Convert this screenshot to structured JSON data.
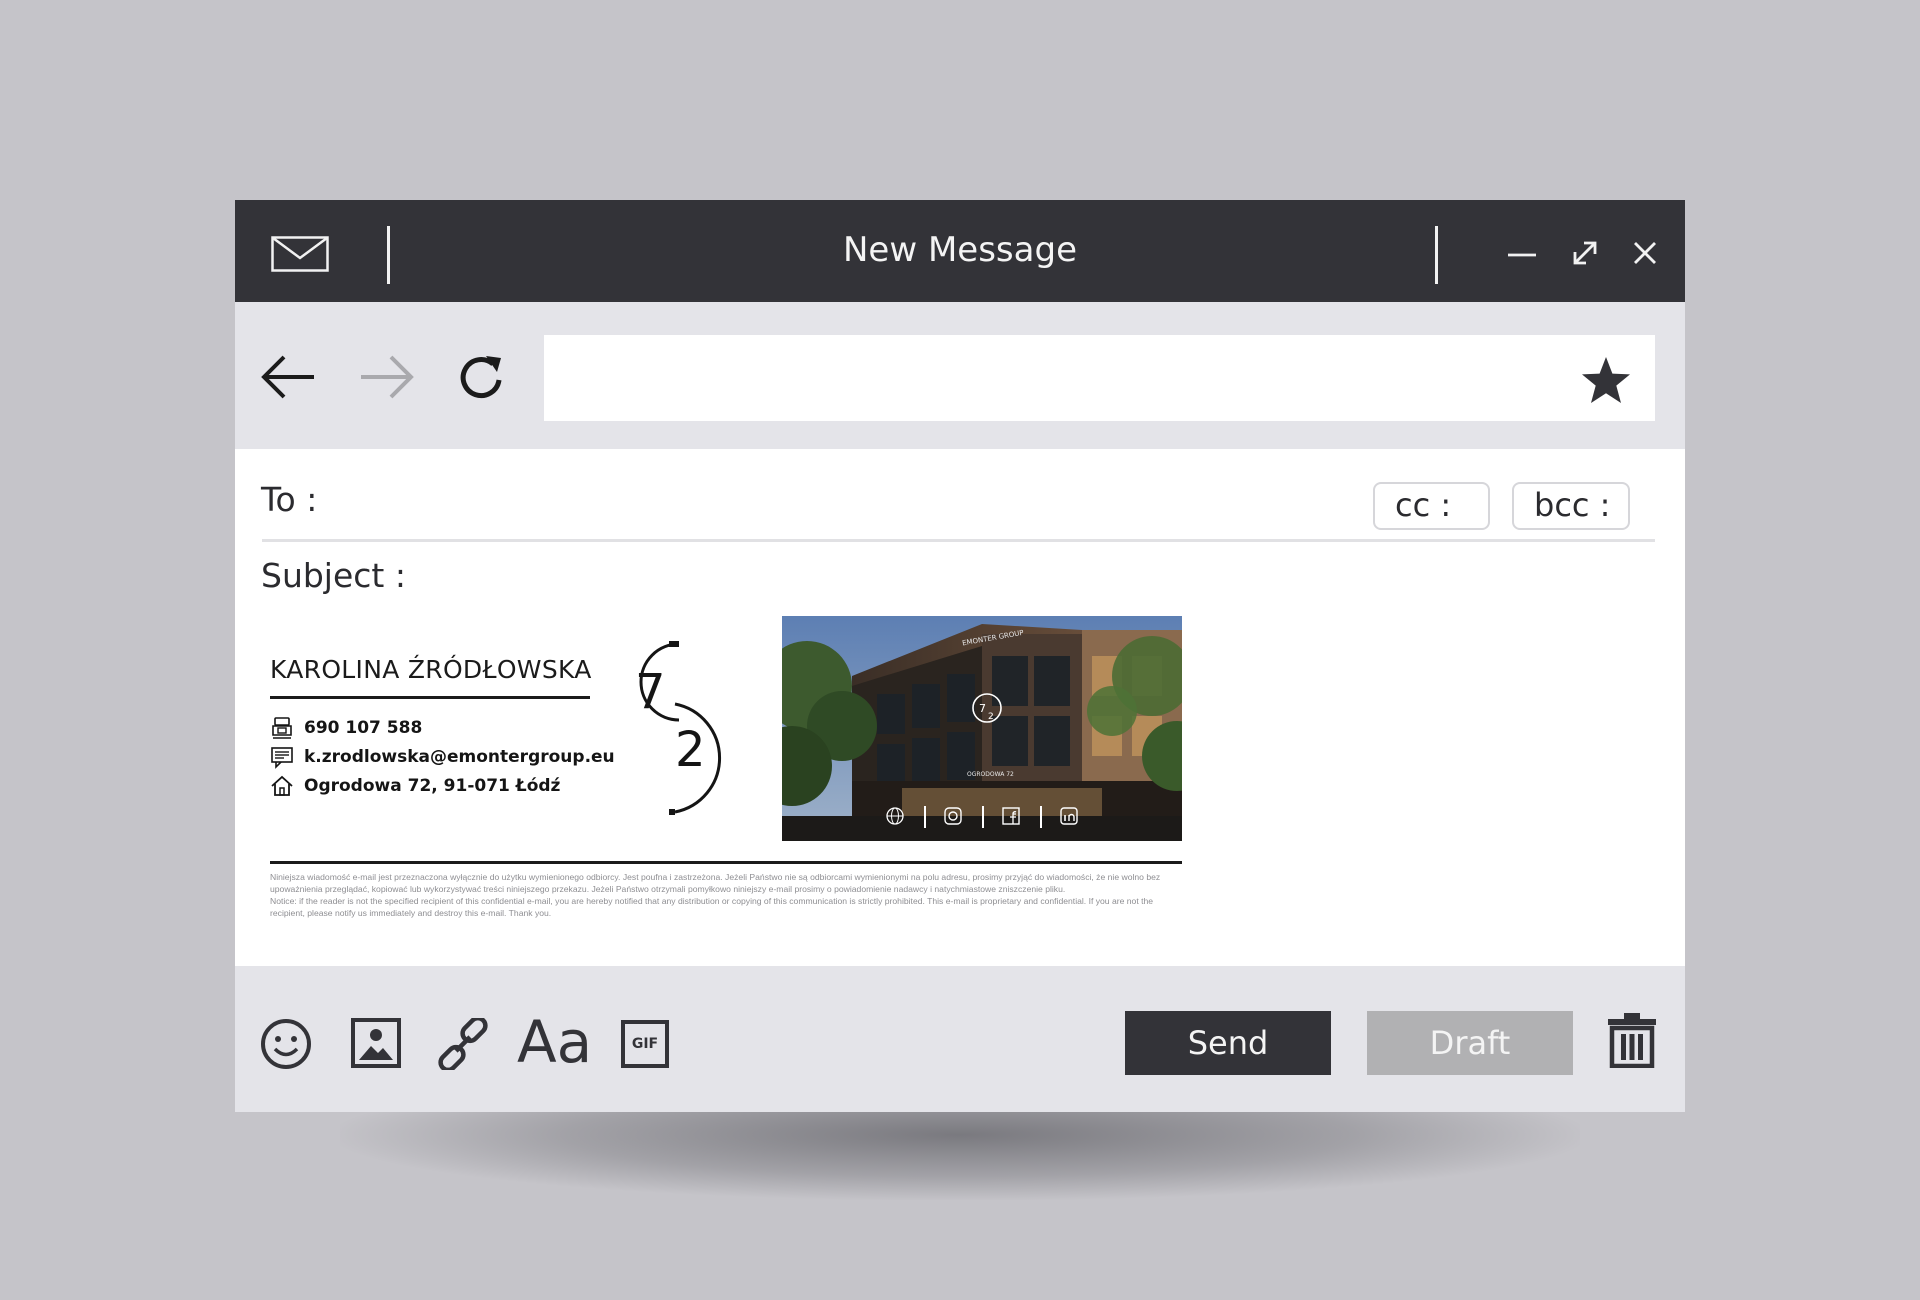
{
  "window": {
    "title": "New Message"
  },
  "navbar": {
    "address_value": ""
  },
  "fields": {
    "to_label": "To :",
    "cc_label": "cc :",
    "bcc_label": "bcc :",
    "subject_label": "Subject :"
  },
  "signature": {
    "name": "KAROLINA ŹRÓDŁOWSKA",
    "phone": "690 107 588",
    "email": "k.zrodlowska@emontergroup.eu",
    "address": "Ogrodowa 72, 91-071 Łódź",
    "logo_digits": [
      "7",
      "2"
    ],
    "photo_sign_brand": "EMONTER GROUP",
    "photo_sign_street": "OGRODOWA 72",
    "disclaimer_pl": "Niniejsza wiadomość e-mail jest przeznaczona wyłącznie do użytku wymienionego odbiorcy. Jest poufna i zastrzeżona. Jeżeli Państwo nie są odbiorcami wymienionymi na polu adresu, prosimy przyjąć do wiadomości, że nie wolno bez upoważnienia przeglądać, kopiować lub wykorzystywać treści niniejszego przekazu. Jeżeli Państwo otrzymali pomyłkowo niniejszy e-mail prosimy o powiadomienie nadawcy i natychmiastowe zniszczenie pliku.",
    "disclaimer_en": "Notice: if the reader is not the specified recipient of this confidential e-mail, you are hereby notified that any distribution or copying of this communication is strictly prohibited. This e-mail is proprietary and confidential. If you are not the recipient, please notify us immediately and destroy this e-mail. Thank you."
  },
  "footer": {
    "font_label": "Aa",
    "gif_label": "GIF",
    "send_label": "Send",
    "draft_label": "Draft"
  },
  "icons": [
    "mail-icon",
    "minimize-icon",
    "expand-icon",
    "close-icon",
    "back-arrow-icon",
    "forward-arrow-icon",
    "reload-icon",
    "star-icon",
    "phone-icon",
    "email-icon",
    "home-icon",
    "globe-icon",
    "instagram-icon",
    "facebook-icon",
    "linkedin-icon",
    "emoji-icon",
    "image-icon",
    "link-icon",
    "gif-icon",
    "trash-icon"
  ],
  "colors": {
    "background": "#c5c4c9",
    "titlebar": "#333338",
    "toolbar": "#e4e4e9",
    "send_button": "#333338",
    "draft_button": "#b1b1b3",
    "forward_arrow_disabled": "#a9a9ad"
  }
}
